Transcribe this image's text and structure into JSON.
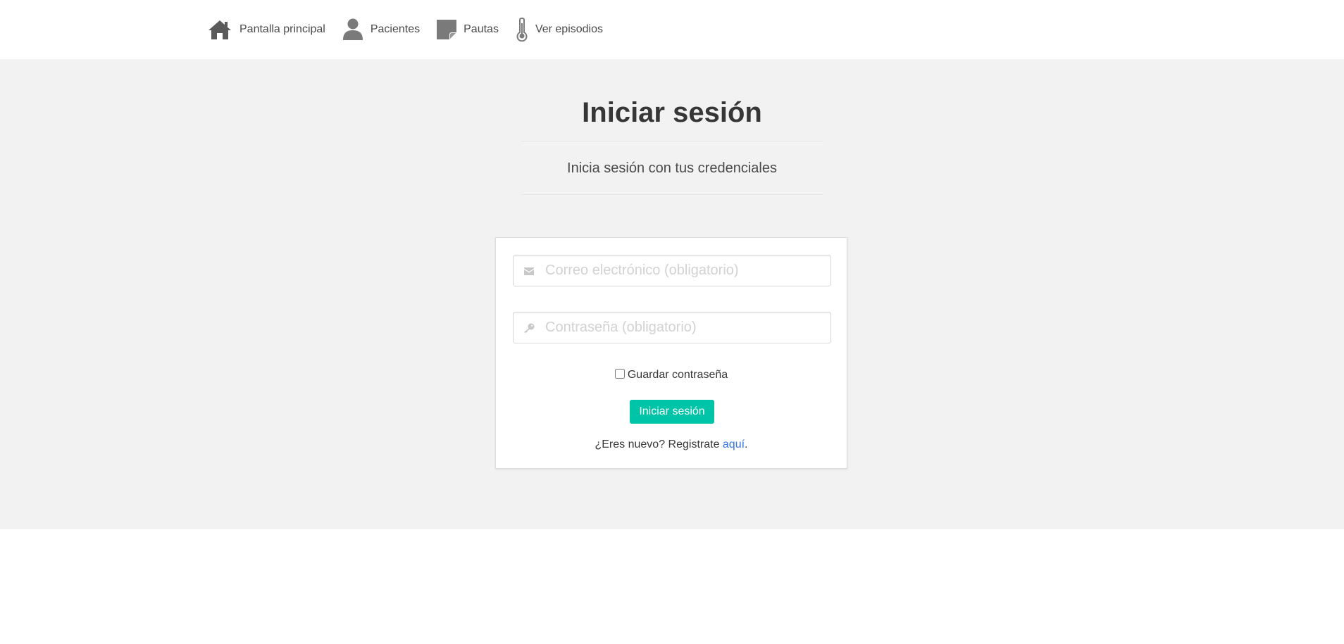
{
  "nav": {
    "items": [
      {
        "label": "Pantalla principal",
        "icon": "home-icon"
      },
      {
        "label": "Pacientes",
        "icon": "user-icon"
      },
      {
        "label": "Pautas",
        "icon": "note-icon"
      },
      {
        "label": "Ver episodios",
        "icon": "thermometer-icon"
      }
    ]
  },
  "hero": {
    "title": "Iniciar sesión",
    "subtitle": "Inicia sesión con tus credenciales"
  },
  "login": {
    "email_placeholder": "Correo electrónico (obligatorio)",
    "password_placeholder": "Contraseña (obligatorio)",
    "remember_label": "Guardar contraseña",
    "remember_checked": false,
    "submit_label": "Iniciar sesión",
    "register_prefix": "¿Eres nuevo? Registrate ",
    "register_link": "aquí",
    "register_suffix": "."
  },
  "colors": {
    "accent": "#00c4a7",
    "link": "#3273dc",
    "hero_bg": "#f2f2f2",
    "icon": "#7a7a7a"
  }
}
